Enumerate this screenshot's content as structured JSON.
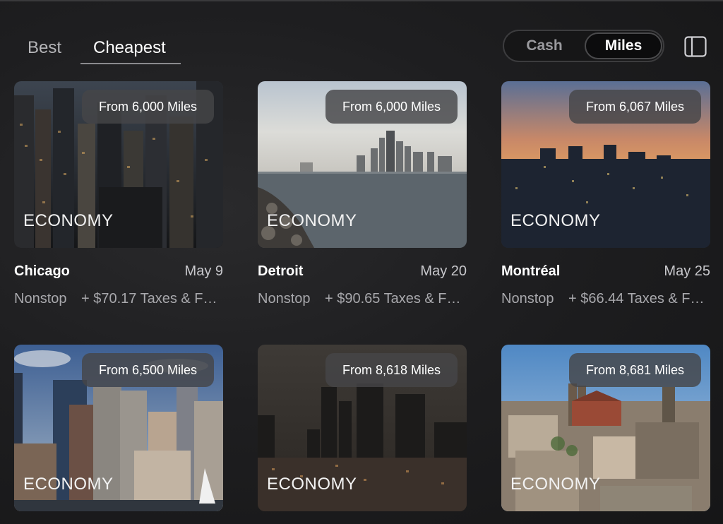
{
  "tabs": {
    "best": "Best",
    "cheapest": "Cheapest",
    "active": "Cheapest"
  },
  "currency_toggle": {
    "cash": "Cash",
    "miles": "Miles",
    "selected": "Miles"
  },
  "sidebar_icon": "sidebar-panel-icon",
  "colors": {
    "background": "#1c1c1e",
    "pill": "#464648",
    "text_secondary": "#a8a8ac"
  },
  "destinations": [
    {
      "price": "From 6,000 Miles",
      "cabin": "ECONOMY",
      "city": "Chicago",
      "date": "May 9",
      "stops": "Nonstop",
      "taxes": "+ $70.17 Taxes & Fees"
    },
    {
      "price": "From 6,000 Miles",
      "cabin": "ECONOMY",
      "city": "Detroit",
      "date": "May 20",
      "stops": "Nonstop",
      "taxes": "+ $90.65 Taxes & Fees"
    },
    {
      "price": "From 6,067 Miles",
      "cabin": "ECONOMY",
      "city": "Montréal",
      "date": "May 25",
      "stops": "Nonstop",
      "taxes": "+ $66.44 Taxes & Fees"
    },
    {
      "price": "From 6,500 Miles",
      "cabin": "ECONOMY"
    },
    {
      "price": "From 8,618 Miles",
      "cabin": "ECONOMY"
    },
    {
      "price": "From 8,681 Miles",
      "cabin": "ECONOMY"
    }
  ]
}
